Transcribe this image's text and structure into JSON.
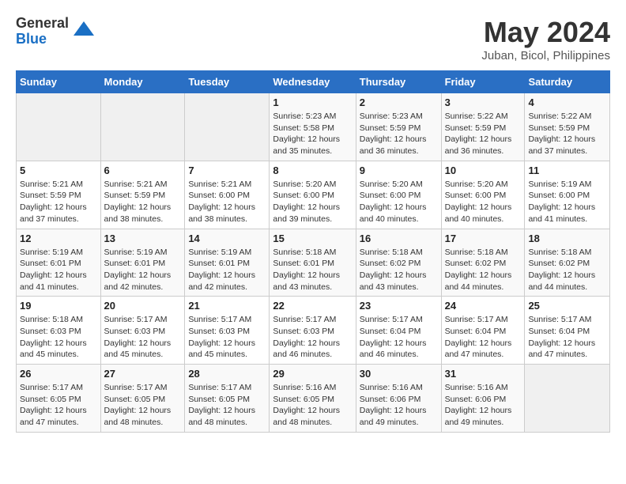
{
  "header": {
    "logo_general": "General",
    "logo_blue": "Blue",
    "month_title": "May 2024",
    "location": "Juban, Bicol, Philippines"
  },
  "weekdays": [
    "Sunday",
    "Monday",
    "Tuesday",
    "Wednesday",
    "Thursday",
    "Friday",
    "Saturday"
  ],
  "weeks": [
    [
      {
        "day": "",
        "sunrise": "",
        "sunset": "",
        "daylight": ""
      },
      {
        "day": "",
        "sunrise": "",
        "sunset": "",
        "daylight": ""
      },
      {
        "day": "",
        "sunrise": "",
        "sunset": "",
        "daylight": ""
      },
      {
        "day": "1",
        "sunrise": "Sunrise: 5:23 AM",
        "sunset": "Sunset: 5:58 PM",
        "daylight": "Daylight: 12 hours and 35 minutes."
      },
      {
        "day": "2",
        "sunrise": "Sunrise: 5:23 AM",
        "sunset": "Sunset: 5:59 PM",
        "daylight": "Daylight: 12 hours and 36 minutes."
      },
      {
        "day": "3",
        "sunrise": "Sunrise: 5:22 AM",
        "sunset": "Sunset: 5:59 PM",
        "daylight": "Daylight: 12 hours and 36 minutes."
      },
      {
        "day": "4",
        "sunrise": "Sunrise: 5:22 AM",
        "sunset": "Sunset: 5:59 PM",
        "daylight": "Daylight: 12 hours and 37 minutes."
      }
    ],
    [
      {
        "day": "5",
        "sunrise": "Sunrise: 5:21 AM",
        "sunset": "Sunset: 5:59 PM",
        "daylight": "Daylight: 12 hours and 37 minutes."
      },
      {
        "day": "6",
        "sunrise": "Sunrise: 5:21 AM",
        "sunset": "Sunset: 5:59 PM",
        "daylight": "Daylight: 12 hours and 38 minutes."
      },
      {
        "day": "7",
        "sunrise": "Sunrise: 5:21 AM",
        "sunset": "Sunset: 6:00 PM",
        "daylight": "Daylight: 12 hours and 38 minutes."
      },
      {
        "day": "8",
        "sunrise": "Sunrise: 5:20 AM",
        "sunset": "Sunset: 6:00 PM",
        "daylight": "Daylight: 12 hours and 39 minutes."
      },
      {
        "day": "9",
        "sunrise": "Sunrise: 5:20 AM",
        "sunset": "Sunset: 6:00 PM",
        "daylight": "Daylight: 12 hours and 40 minutes."
      },
      {
        "day": "10",
        "sunrise": "Sunrise: 5:20 AM",
        "sunset": "Sunset: 6:00 PM",
        "daylight": "Daylight: 12 hours and 40 minutes."
      },
      {
        "day": "11",
        "sunrise": "Sunrise: 5:19 AM",
        "sunset": "Sunset: 6:00 PM",
        "daylight": "Daylight: 12 hours and 41 minutes."
      }
    ],
    [
      {
        "day": "12",
        "sunrise": "Sunrise: 5:19 AM",
        "sunset": "Sunset: 6:01 PM",
        "daylight": "Daylight: 12 hours and 41 minutes."
      },
      {
        "day": "13",
        "sunrise": "Sunrise: 5:19 AM",
        "sunset": "Sunset: 6:01 PM",
        "daylight": "Daylight: 12 hours and 42 minutes."
      },
      {
        "day": "14",
        "sunrise": "Sunrise: 5:19 AM",
        "sunset": "Sunset: 6:01 PM",
        "daylight": "Daylight: 12 hours and 42 minutes."
      },
      {
        "day": "15",
        "sunrise": "Sunrise: 5:18 AM",
        "sunset": "Sunset: 6:01 PM",
        "daylight": "Daylight: 12 hours and 43 minutes."
      },
      {
        "day": "16",
        "sunrise": "Sunrise: 5:18 AM",
        "sunset": "Sunset: 6:02 PM",
        "daylight": "Daylight: 12 hours and 43 minutes."
      },
      {
        "day": "17",
        "sunrise": "Sunrise: 5:18 AM",
        "sunset": "Sunset: 6:02 PM",
        "daylight": "Daylight: 12 hours and 44 minutes."
      },
      {
        "day": "18",
        "sunrise": "Sunrise: 5:18 AM",
        "sunset": "Sunset: 6:02 PM",
        "daylight": "Daylight: 12 hours and 44 minutes."
      }
    ],
    [
      {
        "day": "19",
        "sunrise": "Sunrise: 5:18 AM",
        "sunset": "Sunset: 6:03 PM",
        "daylight": "Daylight: 12 hours and 45 minutes."
      },
      {
        "day": "20",
        "sunrise": "Sunrise: 5:17 AM",
        "sunset": "Sunset: 6:03 PM",
        "daylight": "Daylight: 12 hours and 45 minutes."
      },
      {
        "day": "21",
        "sunrise": "Sunrise: 5:17 AM",
        "sunset": "Sunset: 6:03 PM",
        "daylight": "Daylight: 12 hours and 45 minutes."
      },
      {
        "day": "22",
        "sunrise": "Sunrise: 5:17 AM",
        "sunset": "Sunset: 6:03 PM",
        "daylight": "Daylight: 12 hours and 46 minutes."
      },
      {
        "day": "23",
        "sunrise": "Sunrise: 5:17 AM",
        "sunset": "Sunset: 6:04 PM",
        "daylight": "Daylight: 12 hours and 46 minutes."
      },
      {
        "day": "24",
        "sunrise": "Sunrise: 5:17 AM",
        "sunset": "Sunset: 6:04 PM",
        "daylight": "Daylight: 12 hours and 47 minutes."
      },
      {
        "day": "25",
        "sunrise": "Sunrise: 5:17 AM",
        "sunset": "Sunset: 6:04 PM",
        "daylight": "Daylight: 12 hours and 47 minutes."
      }
    ],
    [
      {
        "day": "26",
        "sunrise": "Sunrise: 5:17 AM",
        "sunset": "Sunset: 6:05 PM",
        "daylight": "Daylight: 12 hours and 47 minutes."
      },
      {
        "day": "27",
        "sunrise": "Sunrise: 5:17 AM",
        "sunset": "Sunset: 6:05 PM",
        "daylight": "Daylight: 12 hours and 48 minutes."
      },
      {
        "day": "28",
        "sunrise": "Sunrise: 5:17 AM",
        "sunset": "Sunset: 6:05 PM",
        "daylight": "Daylight: 12 hours and 48 minutes."
      },
      {
        "day": "29",
        "sunrise": "Sunrise: 5:16 AM",
        "sunset": "Sunset: 6:05 PM",
        "daylight": "Daylight: 12 hours and 48 minutes."
      },
      {
        "day": "30",
        "sunrise": "Sunrise: 5:16 AM",
        "sunset": "Sunset: 6:06 PM",
        "daylight": "Daylight: 12 hours and 49 minutes."
      },
      {
        "day": "31",
        "sunrise": "Sunrise: 5:16 AM",
        "sunset": "Sunset: 6:06 PM",
        "daylight": "Daylight: 12 hours and 49 minutes."
      },
      {
        "day": "",
        "sunrise": "",
        "sunset": "",
        "daylight": ""
      }
    ]
  ]
}
